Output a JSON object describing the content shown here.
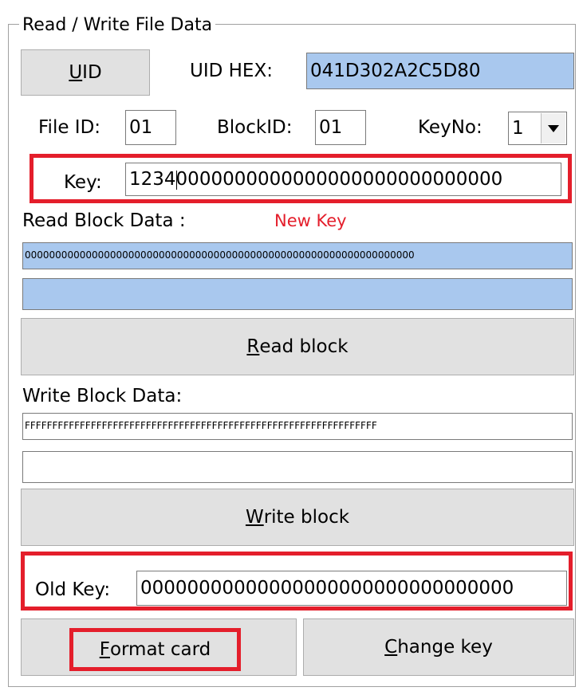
{
  "group_title": "Read / Write File Data",
  "uid": {
    "button_label_u": "U",
    "button_label_rest": "ID",
    "hex_label": "UID HEX:",
    "hex_value": "041D302A2C5D80"
  },
  "file_id": {
    "label": "File ID:",
    "value": "01"
  },
  "block_id": {
    "label": "BlockID:",
    "value": "01"
  },
  "key_no": {
    "label": "KeyNo:",
    "value": "1"
  },
  "key": {
    "label": "Key:",
    "value_before_caret": "1234",
    "value_after_caret": "0000000000000000000000000000"
  },
  "read_block": {
    "label": "Read Block Data :",
    "annotation": "New Key",
    "data_value": "0000000000000000000000000000000000000000000000000000000000000000",
    "second_value": "",
    "button_u": "R",
    "button_rest": "ead block"
  },
  "write_block": {
    "label": "Write Block Data:",
    "data_value": "FFFFFFFFFFFFFFFFFFFFFFFFFFFFFFFFFFFFFFFFFFFFFFFFFFFFFFFFFFFFFFFF",
    "second_value": "",
    "button_u": "W",
    "button_rest": "rite block"
  },
  "old_key": {
    "label": "Old Key:",
    "value": "00000000000000000000000000000000"
  },
  "format_card": {
    "u": "F",
    "rest": "ormat card"
  },
  "change_key": {
    "u": "C",
    "rest": "hange key"
  },
  "colors": {
    "highlight": "#e41e2b",
    "selected_field": "#a9c8ee",
    "button_face": "#e1e1e1"
  },
  "icons": {
    "combo_dropdown": "chevron-down-icon"
  }
}
